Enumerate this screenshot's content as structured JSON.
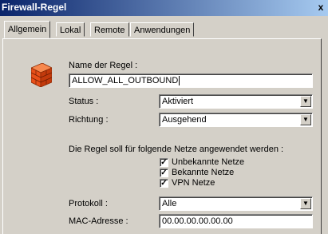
{
  "window": {
    "title": "Firewall-Regel",
    "close_label": "x"
  },
  "tabs": [
    {
      "label": "Allgemein"
    },
    {
      "label": "Lokal"
    },
    {
      "label": "Remote"
    },
    {
      "label": "Anwendungen"
    }
  ],
  "form": {
    "rule_name_label": "Name der Regel :",
    "rule_name_value": "ALLOW_ALL_OUTBOUND",
    "status_label": "Status :",
    "status_value": "Aktiviert",
    "direction_label": "Richtung :",
    "direction_value": "Ausgehend",
    "networks_text": "Die Regel soll für folgende Netze angewendet werden :",
    "networks": [
      {
        "label": "Unbekannte Netze",
        "checked": true
      },
      {
        "label": "Bekannte Netze",
        "checked": true
      },
      {
        "label": "VPN Netze",
        "checked": true
      }
    ],
    "protocol_label": "Protokoll :",
    "protocol_value": "Alle",
    "mac_label": "MAC-Adresse :",
    "mac_value": "00.00.00.00.00.00"
  },
  "icons": {
    "rule_icon": "brick-wall-icon",
    "check": "✓"
  },
  "colors": {
    "title_start": "#0a246a",
    "title_end": "#a6caf0",
    "wall": "#e8501a"
  }
}
